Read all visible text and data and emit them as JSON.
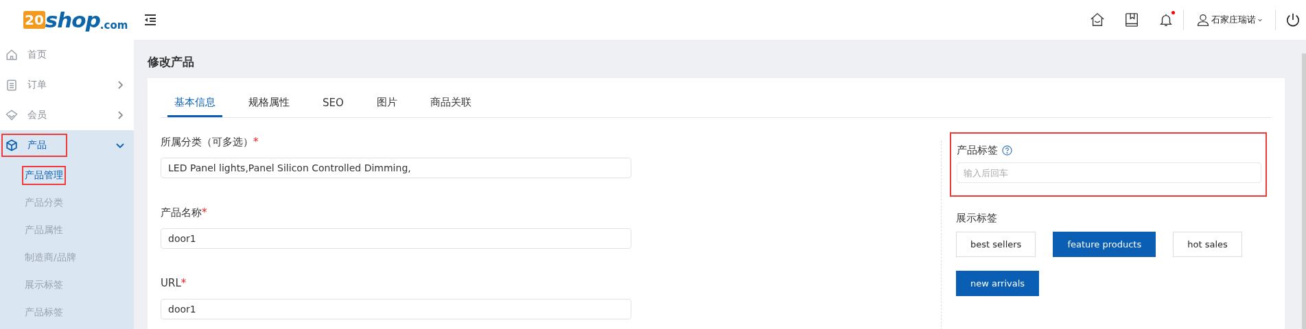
{
  "header": {
    "logo": {
      "digits": "20",
      "word": "shop",
      "suffix": ".com"
    },
    "user": {
      "name": "石家庄瑞诺"
    },
    "notifications": {
      "unread": true
    }
  },
  "sidebar": {
    "items": [
      {
        "kind": "home",
        "label": "首页",
        "selected": false,
        "highlighted": false
      },
      {
        "kind": "orders",
        "label": "订单",
        "selected": false,
        "highlighted": false,
        "expanded": false
      },
      {
        "kind": "members",
        "label": "会员",
        "selected": false,
        "highlighted": false,
        "expanded": false
      },
      {
        "kind": "products",
        "label": "产品",
        "selected": true,
        "highlighted": true,
        "expanded": true,
        "children": [
          {
            "label": "产品管理",
            "selected": true,
            "highlighted": true
          },
          {
            "label": "产品分类",
            "selected": false,
            "highlighted": false
          },
          {
            "label": "产品属性",
            "selected": false,
            "highlighted": false
          },
          {
            "label": "制造商/品牌",
            "selected": false,
            "highlighted": false
          },
          {
            "label": "展示标签",
            "selected": false,
            "highlighted": false
          },
          {
            "label": "产品标签",
            "selected": false,
            "highlighted": false
          }
        ]
      }
    ]
  },
  "page": {
    "title": "修改产品"
  },
  "tabs": [
    {
      "label": "基本信息",
      "selected": true
    },
    {
      "label": "规格属性",
      "selected": false
    },
    {
      "label": "SEO",
      "selected": false
    },
    {
      "label": "图片",
      "selected": false
    },
    {
      "label": "商品关联",
      "selected": false
    }
  ],
  "form": {
    "fields": [
      {
        "label": "所属分类（可多选）",
        "required_mark": "*",
        "value": "LED Panel lights,Panel Silicon Controlled Dimming,"
      },
      {
        "label": "产品名称",
        "required_mark": "*",
        "value": "door1"
      },
      {
        "label": "URL",
        "required_mark": "*",
        "value": "door1"
      }
    ]
  },
  "product_tags": {
    "label": "产品标签",
    "placeholder": "输入后回车",
    "highlighted": true
  },
  "display_tags": {
    "label": "展示标签",
    "options": [
      {
        "label": "best sellers",
        "selected": false
      },
      {
        "label": "feature products",
        "selected": true
      },
      {
        "label": "hot sales",
        "selected": false
      },
      {
        "label": "new arrivals",
        "selected": true
      }
    ]
  }
}
